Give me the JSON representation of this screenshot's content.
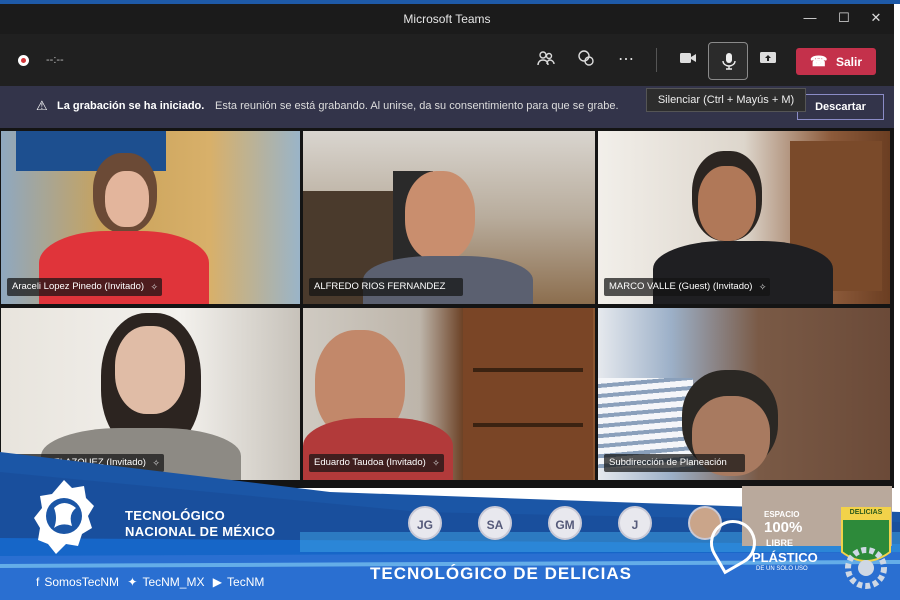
{
  "window": {
    "title": "Microsoft Teams"
  },
  "toolbar": {
    "timer": "--:--",
    "leave_label": "Salir"
  },
  "banner": {
    "title": "La grabación se ha iniciado.",
    "message": "Esta reunión se está grabando. Al unirse, da su consentimiento para que se grabe.",
    "dismiss_label": "Descartar"
  },
  "tooltip": {
    "mute": "Silenciar (Ctrl + Mayús + M)"
  },
  "participants": [
    {
      "name": "Araceli Lopez Pinedo (Invitado)"
    },
    {
      "name": "ALFREDO RIOS FERNANDEZ"
    },
    {
      "name": "MARCO VALLE (Guest) (Invitado)"
    },
    {
      "name": "MAYRA VELAZQUEZ (Invitado)"
    },
    {
      "name": "Eduardo Taudoa (Invitado)"
    },
    {
      "name": "Subdirección de Planeación"
    }
  ],
  "avatars": [
    "JG",
    "SA",
    "GM",
    "J"
  ],
  "branding": {
    "org_line1": "TECNOLÓGICO",
    "org_line2": "NACIONAL DE MÉXICO",
    "facebook": "SomosTecNM",
    "twitter": "TecNM_MX",
    "youtube": "TecNM",
    "campus": "TECNOLÓGICO DE  DELICIAS",
    "badge_l1": "ESPACIO",
    "badge_l2": "100%",
    "badge_l3": "LIBRE",
    "badge_l4": "PLÁSTICO",
    "badge_l5": "DE UN SOLO USO",
    "crest": "DELICIAS"
  },
  "colors": {
    "leave": "#c4314b",
    "banner": "#33344a",
    "brand_blue": "#1e5aa8"
  }
}
